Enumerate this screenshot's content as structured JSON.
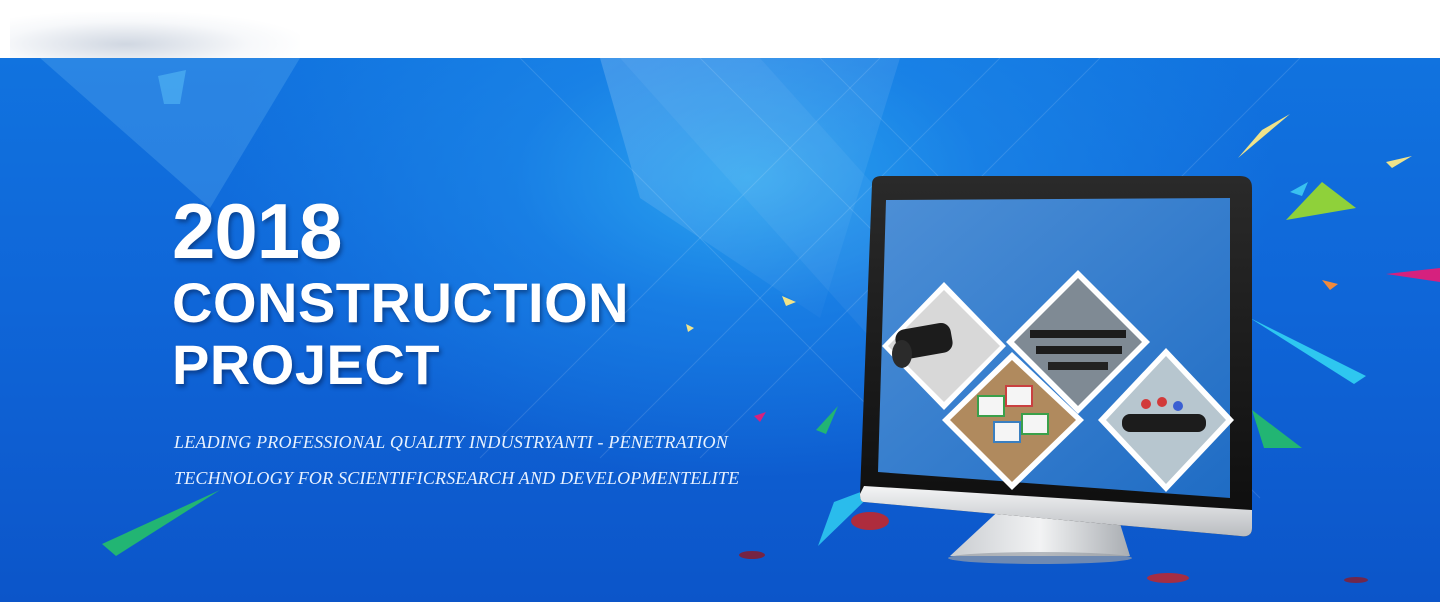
{
  "hero": {
    "year": "2018",
    "line1": "CONSTRUCTION",
    "line2": "PROJECT",
    "subtitle_line1": "LEADING PROFESSIONAL QUALITY INDUSTRYANTI - PENETRATION",
    "subtitle_line2": "TECHNOLOGY FOR SCIENTIFICRSEARCH AND DEVELOPMENTELITE"
  },
  "colors": {
    "banner_blue": "#0f66d8",
    "accent_yellow": "#f0e38a",
    "accent_green": "#22b573",
    "accent_magenta": "#d6217e",
    "accent_red": "#c0272d",
    "accent_cyan": "#2ec7f0"
  },
  "icons": [
    "monitor-illustration",
    "geomembrane-roll-photo",
    "warehouse-pipes-photo",
    "swatch-samples-photo",
    "workers-laying-photo"
  ]
}
